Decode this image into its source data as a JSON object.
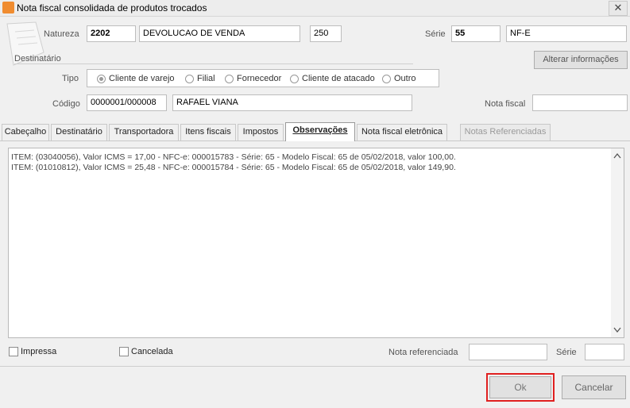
{
  "window": {
    "title": "Nota fiscal consolidada de produtos trocados",
    "close_glyph": "✕"
  },
  "header": {
    "natureza_label": "Natureza",
    "natureza_code": "2202",
    "natureza_desc": "DEVOLUCAO DE VENDA",
    "natureza_num": "250",
    "serie_label": "Série",
    "serie_value": "55",
    "serie_type": "NF-E",
    "destinatario_label": "Destinatário",
    "alterar_button": "Alterar informações",
    "tipo_label": "Tipo",
    "tipo_options": [
      "Cliente de varejo",
      "Filial",
      "Fornecedor",
      "Cliente de atacado",
      "Outro"
    ],
    "tipo_selected": "Cliente de varejo",
    "codigo_label": "Código",
    "codigo_value": "0000001/000008",
    "cliente_nome": "RAFAEL VIANA",
    "nota_fiscal_label": "Nota fiscal",
    "nota_fiscal_value": ""
  },
  "tabs": [
    {
      "label": "Cabeçalho",
      "active": false,
      "disabled": false
    },
    {
      "label": "Destinatário",
      "active": false,
      "disabled": false
    },
    {
      "label": "Transportadora",
      "active": false,
      "disabled": false
    },
    {
      "label": "Itens fiscais",
      "active": false,
      "disabled": false
    },
    {
      "label": "Impostos",
      "active": false,
      "disabled": false
    },
    {
      "label": "Observações",
      "active": true,
      "disabled": false
    },
    {
      "label": "Nota fiscal eletrônica",
      "active": false,
      "disabled": false
    },
    {
      "label": "Notas Referenciadas",
      "active": false,
      "disabled": true
    }
  ],
  "observacoes": [
    "ITEM:  (03040056), Valor ICMS = 17,00 - NFC-e: 000015783 - Série: 65 - Modelo Fiscal: 65 de 05/02/2018, valor 100,00.",
    "ITEM:  (01010812), Valor ICMS = 25,48 - NFC-e: 000015784 - Série: 65 - Modelo Fiscal: 65 de 05/02/2018, valor 149,90."
  ],
  "footer": {
    "impressa_label": "Impressa",
    "cancelada_label": "Cancelada",
    "nota_referenciada_label": "Nota referenciada",
    "nota_referenciada_value": "",
    "serie_label": "Série",
    "serie_value": ""
  },
  "buttons": {
    "ok": "Ok",
    "cancelar": "Cancelar"
  },
  "colors": {
    "highlight": "#e02020",
    "title_icon": "#f08c30"
  }
}
